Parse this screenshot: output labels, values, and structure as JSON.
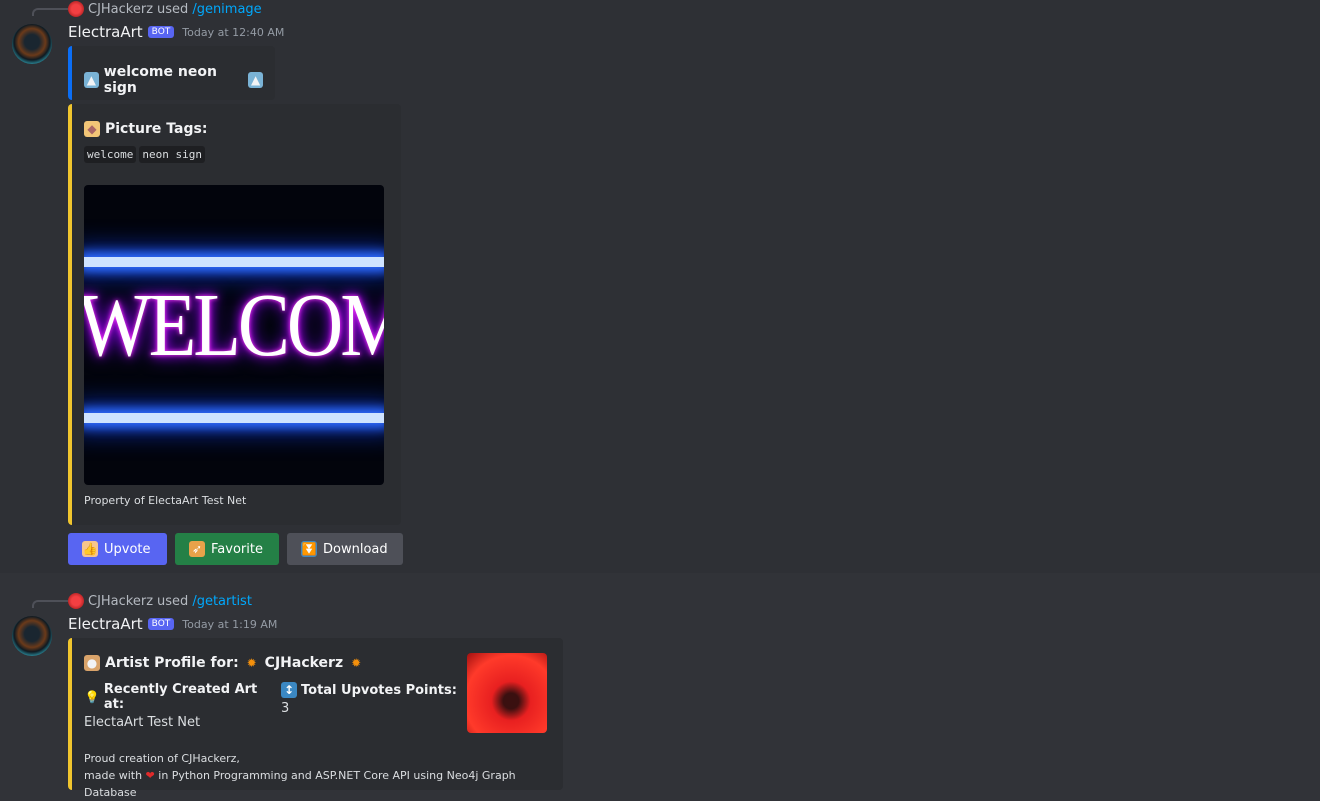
{
  "messages": [
    {
      "reply_user": "CJHackerz",
      "reply_verb": "used",
      "command": "/genimage",
      "author": "ElectraArt",
      "badge": "BOT",
      "time": "Today at 12:40 AM",
      "title_embed": {
        "title": "welcome neon sign",
        "color": "#0b6ef5"
      },
      "tags_embed": {
        "title": "Picture Tags:",
        "tags": [
          "welcome",
          "neon sign"
        ],
        "image_text": "WELCOME",
        "footer": "Property of ElectaArt Test Net",
        "color": "#f0c52e"
      },
      "buttons": [
        {
          "label": "Upvote",
          "icon": "thumbs-up-icon",
          "color": "#5865f2"
        },
        {
          "label": "Favorite",
          "icon": "rocket-icon",
          "color": "#248046"
        },
        {
          "label": "Download",
          "icon": "download-arrow-icon",
          "color": "#4e5058"
        }
      ]
    },
    {
      "reply_user": "CJHackerz",
      "reply_verb": "used",
      "command": "/getartist",
      "author": "ElectraArt",
      "badge": "BOT",
      "time": "Today at 1:19 AM",
      "profile_embed": {
        "title_prefix": "Artist Profile for:",
        "artist": "CJHackerz",
        "color": "#f0c52e",
        "fields": [
          {
            "name": "Recently Created Art at:",
            "value": "ElectaArt Test Net",
            "icon": "light-bulb-icon"
          },
          {
            "name": "Total Upvotes Points:",
            "value": "3",
            "icon": "up-down-arrow-icon"
          }
        ],
        "desc_line1": "Proud creation of CJHackerz,",
        "desc_line2_pre": "made with",
        "desc_line2_post": "in Python Programming and ASP.NET Core API using Neo4j Graph Database"
      }
    }
  ]
}
